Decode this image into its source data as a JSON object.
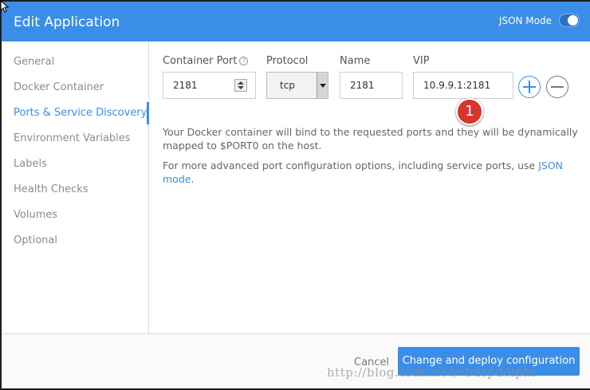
{
  "header": {
    "title": "Edit Application",
    "json_mode_label": "JSON Mode",
    "json_mode_on": false
  },
  "sidebar": {
    "items": [
      {
        "label": "General"
      },
      {
        "label": "Docker Container"
      },
      {
        "label": "Ports & Service Discovery",
        "active": true
      },
      {
        "label": "Environment Variables"
      },
      {
        "label": "Labels"
      },
      {
        "label": "Health Checks"
      },
      {
        "label": "Volumes"
      },
      {
        "label": "Optional"
      }
    ]
  },
  "ports": {
    "container_port_label": "Container Port",
    "container_port_value": "2181",
    "protocol_label": "Protocol",
    "protocol_value": "tcp",
    "name_label": "Name",
    "name_value": "2181",
    "vip_label": "VIP",
    "vip_value": "10.9.9.1:2181"
  },
  "annotation_badge": "1",
  "info": {
    "line1": "Your Docker container will bind to the requested ports and they will be dynamically",
    "line2": "mapped to $PORT0 on the host.",
    "advanced_prefix": "For more advanced port configuration options, including service ports, use ",
    "advanced_link": "JSON mode",
    "advanced_suffix": "."
  },
  "footer": {
    "cancel_label": "Cancel",
    "deploy_label": "Change and deploy configuration"
  },
  "watermark": "http://blog.csdn.net/vbaspdelphi",
  "colors": {
    "accent": "#3b8ee8",
    "badge": "#d8332c"
  }
}
